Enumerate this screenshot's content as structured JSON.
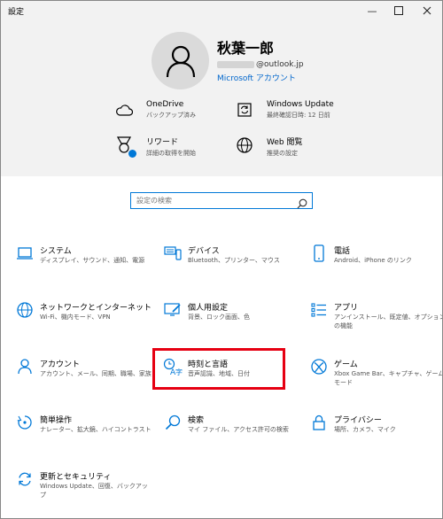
{
  "window": {
    "title": "設定"
  },
  "profile": {
    "name": "秋葉一郎",
    "email_domain": "@outlook.jp",
    "account_link": "Microsoft アカウント"
  },
  "quick": [
    {
      "title": "OneDrive",
      "sub": "バックアップ済み",
      "icon": "cloud-icon"
    },
    {
      "title": "Windows Update",
      "sub": "最終確認日時: 12 日前",
      "icon": "update-icon"
    },
    {
      "title": "リワード",
      "sub": "詳細の取得を開始",
      "icon": "reward-medal-icon"
    },
    {
      "title": "Web 閲覧",
      "sub": "推奨の設定",
      "icon": "globe-icon"
    }
  ],
  "search": {
    "placeholder": "設定の検索"
  },
  "tiles": [
    {
      "title": "システム",
      "sub": "ディスプレイ、サウンド、通知、電源",
      "icon": "laptop-icon"
    },
    {
      "title": "デバイス",
      "sub": "Bluetooth、プリンター、マウス",
      "icon": "keyboard-icon"
    },
    {
      "title": "電話",
      "sub": "Android、iPhone のリンク",
      "icon": "phone-icon"
    },
    {
      "title": "ネットワークとインターネット",
      "sub": "Wi-Fi、機内モード、VPN",
      "icon": "globe-icon"
    },
    {
      "title": "個人用設定",
      "sub": "背景、ロック画面、色",
      "icon": "personalization-icon"
    },
    {
      "title": "アプリ",
      "sub": "アンインストール、既定値、オプションの機能",
      "icon": "apps-list-icon"
    },
    {
      "title": "アカウント",
      "sub": "アカウント、メール、同期、職場、家族",
      "icon": "person-icon"
    },
    {
      "title": "時刻と言語",
      "sub": "音声認識、地域、日付",
      "icon": "time-language-icon"
    },
    {
      "title": "ゲーム",
      "sub": "Xbox Game Bar、キャプチャ、ゲーム モード",
      "icon": "xbox-icon"
    },
    {
      "title": "簡単操作",
      "sub": "ナレーター、拡大鏡、ハイコントラスト",
      "icon": "ease-of-access-icon"
    },
    {
      "title": "検索",
      "sub": "マイ ファイル、アクセス許可の検索",
      "icon": "search-icon"
    },
    {
      "title": "プライバシー",
      "sub": "場所、カメラ、マイク",
      "icon": "lock-icon"
    },
    {
      "title": "更新とセキュリティ",
      "sub": "Windows Update、回復、バックアップ",
      "icon": "update-icon"
    }
  ],
  "colors": {
    "accent": "#0078d7",
    "highlight": "#e60012",
    "header_bg": "#f2f2f2"
  }
}
